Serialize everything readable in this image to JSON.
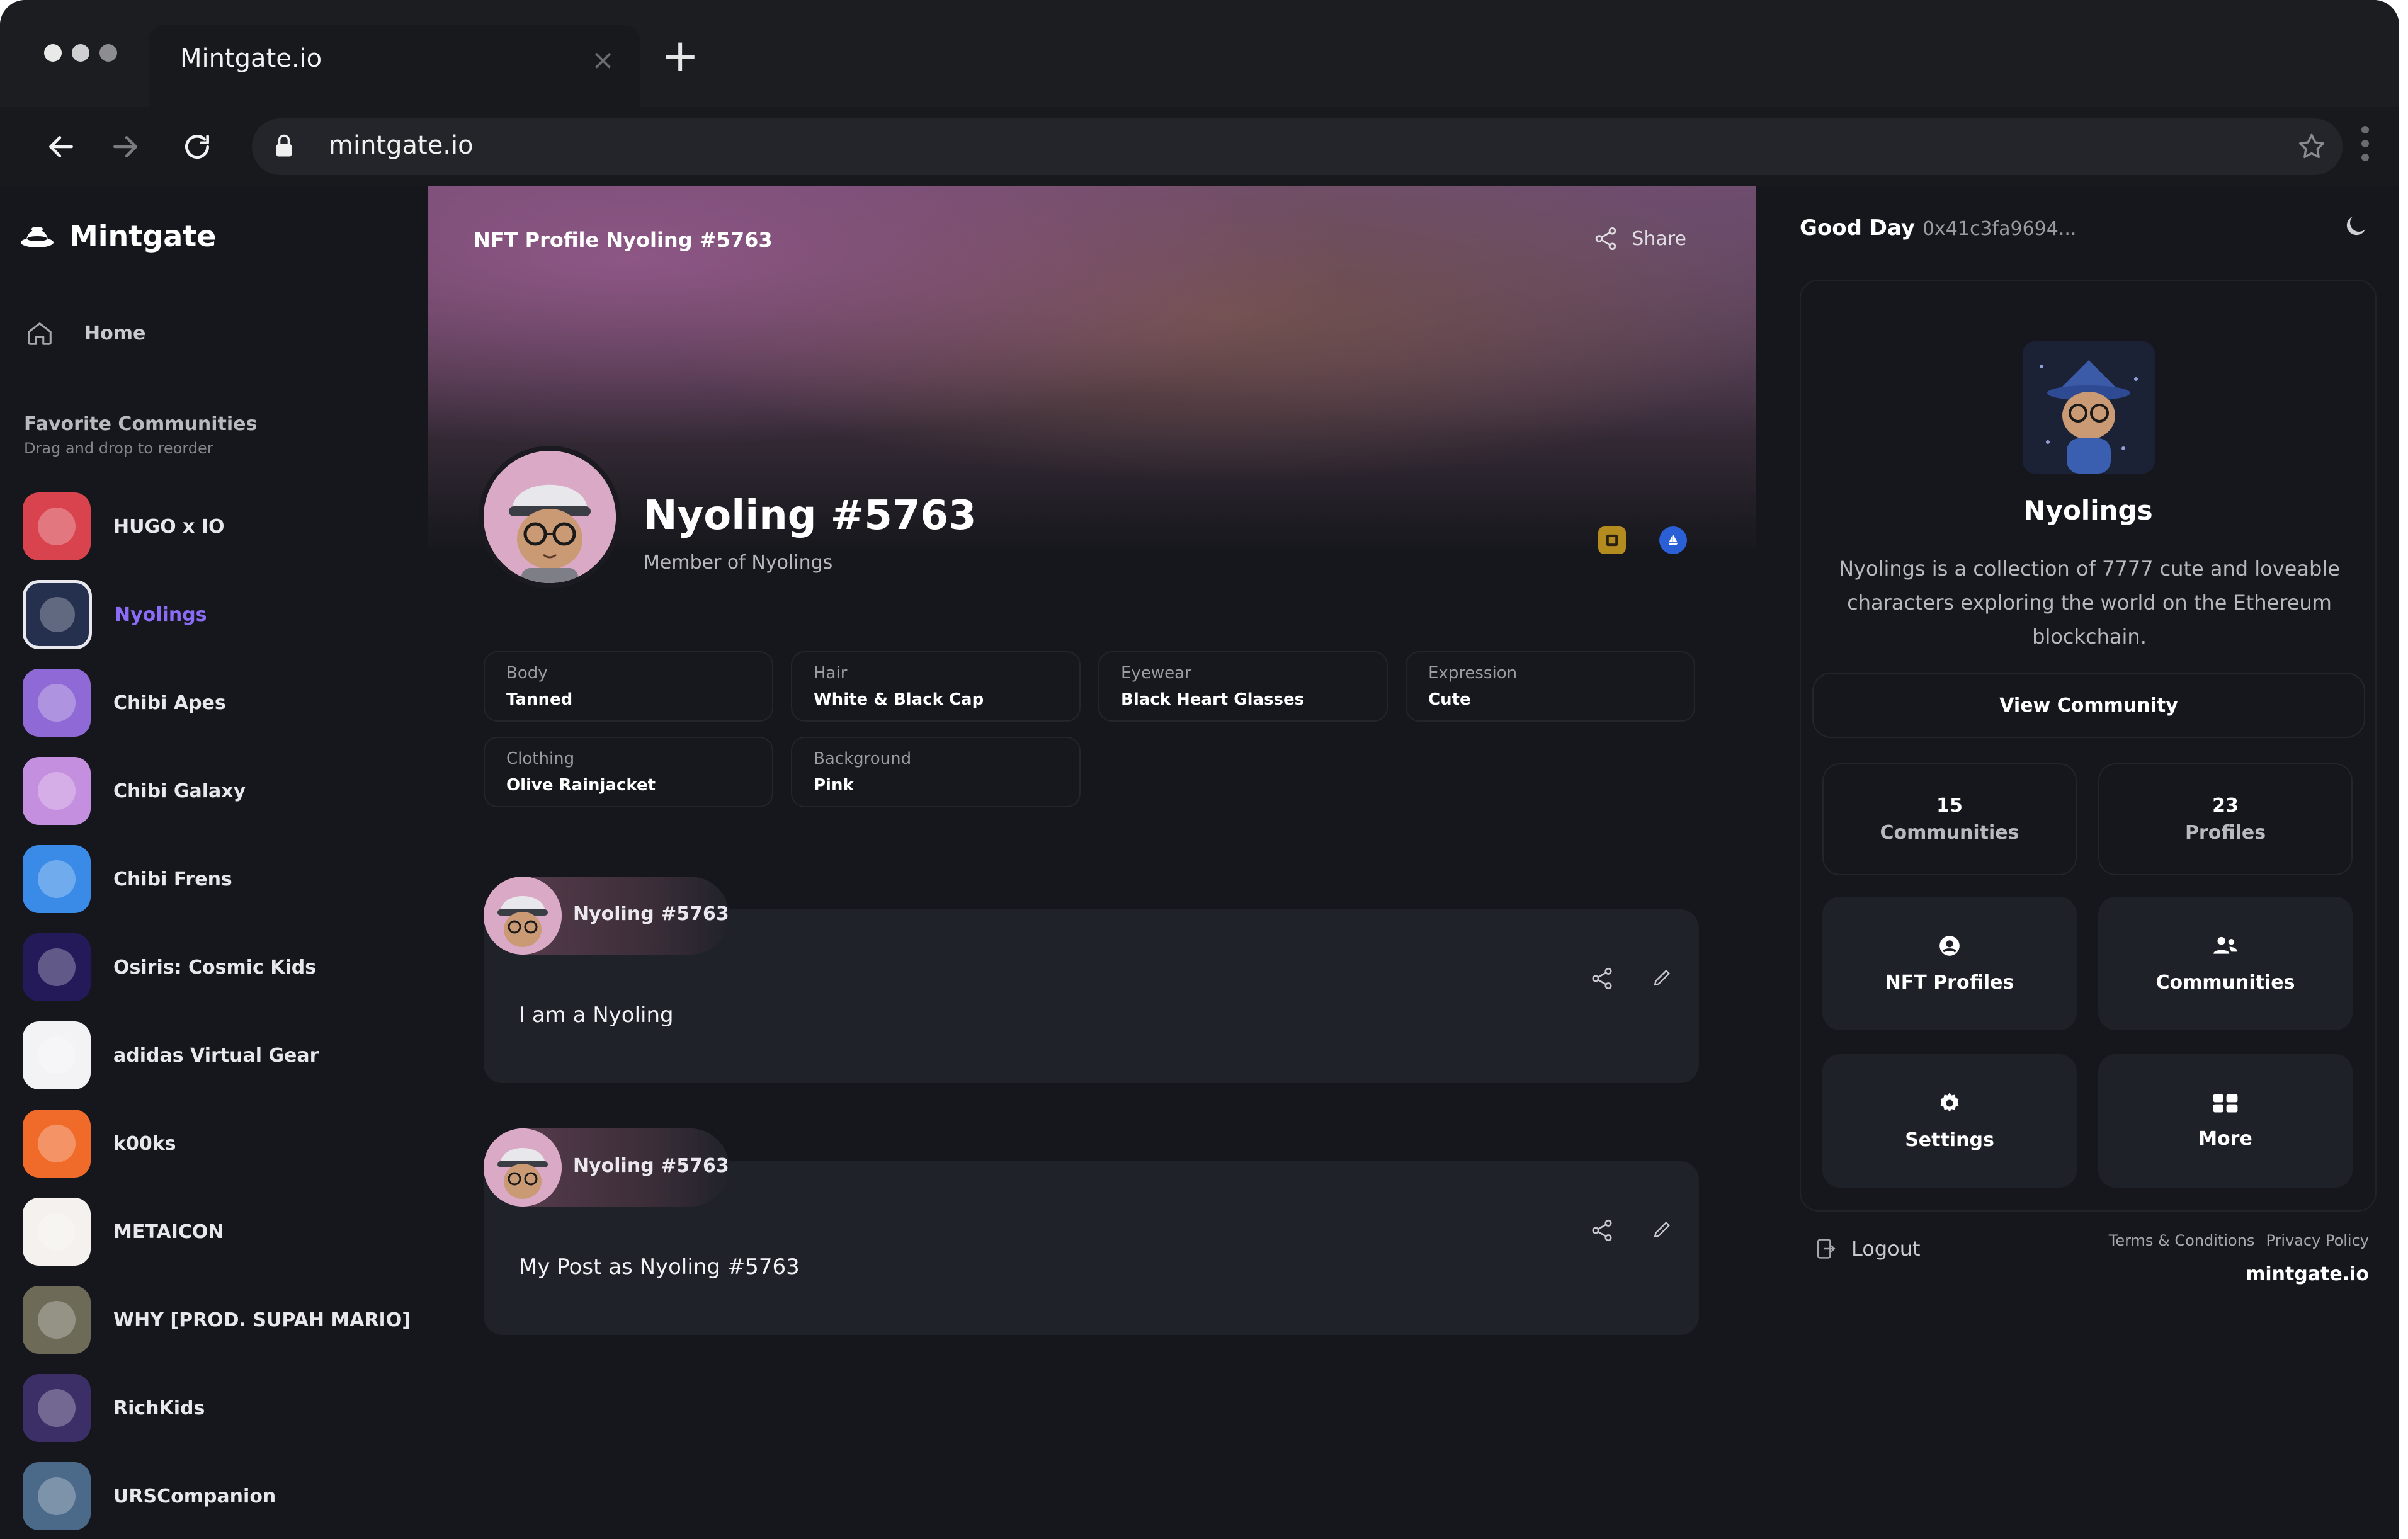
{
  "browser": {
    "tab_title": "Mintgate.io",
    "tab_close": "×",
    "new_tab": "+",
    "url": "mintgate.io"
  },
  "sidebar": {
    "brand": "Mintgate",
    "home_label": "Home",
    "favorites_title": "Favorite Communities",
    "favorites_subtitle": "Drag and drop to reorder",
    "communities": [
      {
        "label": "HUGO x IO",
        "color": "#d9434e"
      },
      {
        "label": "Nyolings",
        "color": "#25304f",
        "active": true
      },
      {
        "label": "Chibi Apes",
        "color": "#8f6ad6"
      },
      {
        "label": "Chibi Galaxy",
        "color": "#c58fe0"
      },
      {
        "label": "Chibi Frens",
        "color": "#3a8be8"
      },
      {
        "label": "Osiris: Cosmic Kids",
        "color": "#241a59"
      },
      {
        "label": "adidas Virtual Gear",
        "color": "#f3f3f5"
      },
      {
        "label": "k00ks",
        "color": "#f06a2a"
      },
      {
        "label": "METAICON",
        "color": "#f4f1ee"
      },
      {
        "label": "WHY [PROD. SUPAH MARIO]",
        "color": "#6d6a57"
      },
      {
        "label": "RichKids",
        "color": "#3c2f68"
      },
      {
        "label": "URSCompanion",
        "color": "#4b6a8a"
      }
    ]
  },
  "main": {
    "header_title": "NFT Profile Nyoling #5763",
    "share_label": "Share",
    "profile_name": "Nyoling #5763",
    "profile_sub": "Member of Nyolings",
    "traits": [
      {
        "key": "Body",
        "value": "Tanned"
      },
      {
        "key": "Hair",
        "value": "White & Black Cap"
      },
      {
        "key": "Eyewear",
        "value": "Black Heart Glasses"
      },
      {
        "key": "Expression",
        "value": "Cute"
      },
      {
        "key": "Clothing",
        "value": "Olive Rainjacket"
      },
      {
        "key": "Background",
        "value": "Pink"
      }
    ],
    "posts": [
      {
        "author": "Nyoling #5763",
        "text": "I am a Nyoling"
      },
      {
        "author": "Nyoling #5763",
        "text": "My Post as Nyoling #5763"
      }
    ]
  },
  "right": {
    "greeting": "Good Day",
    "address": "0x41c3fa9694...",
    "community_name": "Nyolings",
    "community_desc": "Nyolings is a collection of 7777 cute and loveable characters exploring the world on the Ethereum blockchain.",
    "view_button": "View Community",
    "stats": [
      {
        "num": "15",
        "label": "Communities"
      },
      {
        "num": "23",
        "label": "Profiles"
      }
    ],
    "tiles": [
      {
        "label": "NFT Profiles",
        "icon": "user-circle-icon"
      },
      {
        "label": "Communities",
        "icon": "users-icon"
      },
      {
        "label": "Settings",
        "icon": "gear-icon"
      },
      {
        "label": "More",
        "icon": "grid-icon"
      }
    ],
    "logout": "Logout",
    "terms": "Terms & Conditions",
    "privacy": "Privacy Policy",
    "domain": "mintgate.io"
  },
  "colors": {
    "accent": "#8b6cf6",
    "background": "#16171c",
    "card": "#20222a"
  }
}
